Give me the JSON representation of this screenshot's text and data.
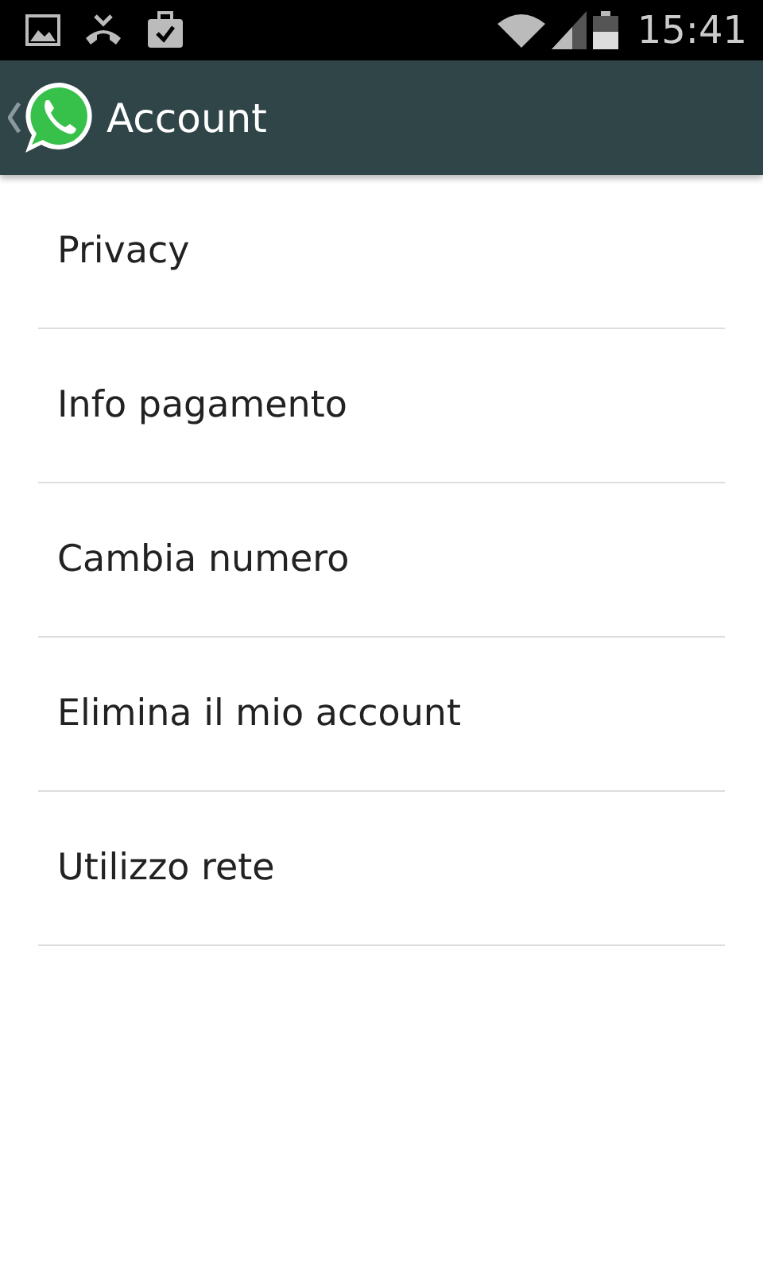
{
  "status_bar": {
    "time": "15:41"
  },
  "app_bar": {
    "title": "Account"
  },
  "menu_items": [
    {
      "label": "Privacy"
    },
    {
      "label": "Info pagamento"
    },
    {
      "label": "Cambia numero"
    },
    {
      "label": "Elimina il mio account"
    },
    {
      "label": "Utilizzo rete"
    }
  ]
}
